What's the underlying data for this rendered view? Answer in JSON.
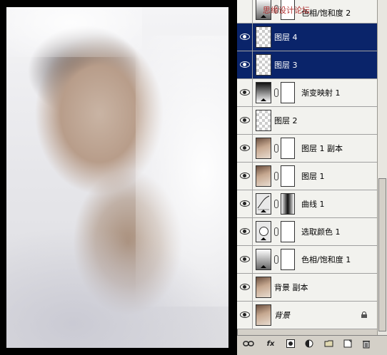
{
  "layers": [
    {
      "name": "色相/饱和度 2",
      "visible": false,
      "selected": false,
      "thumb": "adj-huesat",
      "mask": true,
      "partial": true
    },
    {
      "name": "图层 4",
      "visible": true,
      "selected": true,
      "thumb": "checker",
      "mask": false
    },
    {
      "name": "图层 3",
      "visible": true,
      "selected": true,
      "thumb": "checker",
      "mask": false
    },
    {
      "name": "渐变映射 1",
      "visible": true,
      "selected": false,
      "thumb": "adj-gradient",
      "mask": true
    },
    {
      "name": "图层 2",
      "visible": true,
      "selected": false,
      "thumb": "checker",
      "mask": false
    },
    {
      "name": "图层 1 副本",
      "visible": true,
      "selected": false,
      "thumb": "photo",
      "mask": true
    },
    {
      "name": "图层 1",
      "visible": true,
      "selected": false,
      "thumb": "photo",
      "mask": true
    },
    {
      "name": "曲线 1",
      "visible": true,
      "selected": false,
      "thumb": "curve",
      "mask": true
    },
    {
      "name": "选取颜色 1",
      "visible": true,
      "selected": false,
      "thumb": "select",
      "mask": true
    },
    {
      "name": "色相/饱和度 1",
      "visible": true,
      "selected": false,
      "thumb": "adj-huesat",
      "mask": true
    },
    {
      "name": "背景 副本",
      "visible": true,
      "selected": false,
      "thumb": "photo",
      "mask": false
    },
    {
      "name": "背景",
      "visible": true,
      "selected": false,
      "thumb": "photo",
      "mask": false,
      "locked": true
    }
  ],
  "watermark": "思缘设计论坛",
  "footer": {
    "icons": [
      "link-icon",
      "fx-icon",
      "add-mask-icon",
      "adjustment-icon",
      "folder-icon",
      "new-layer-icon",
      "trash-icon"
    ],
    "fx_label": "fx"
  },
  "colors": {
    "selected_row": "#0a246a",
    "panel_bg": "#d4d0c8"
  }
}
